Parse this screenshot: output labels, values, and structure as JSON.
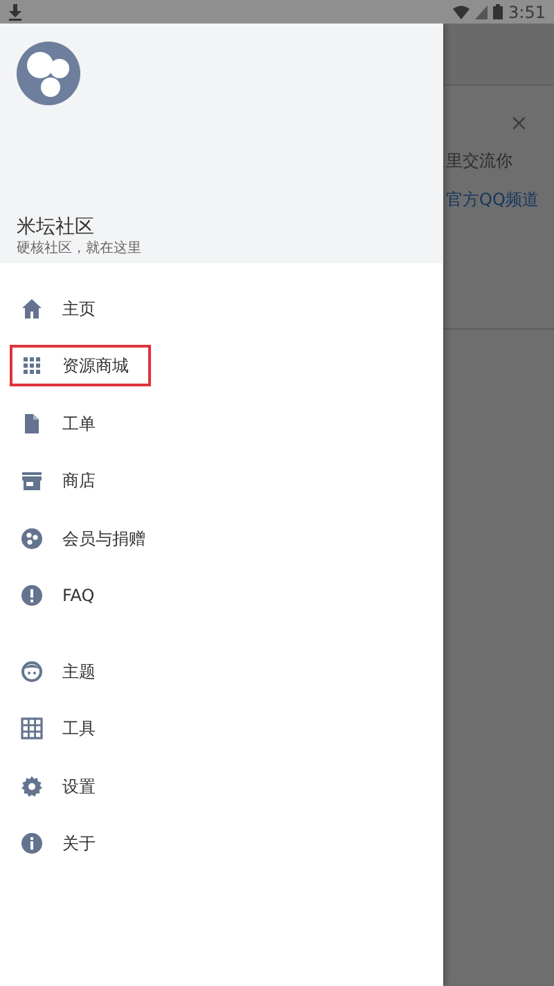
{
  "status_bar": {
    "time": "3:51"
  },
  "background": {
    "message": "里交流你",
    "link": "官方QQ频道",
    "close": "×"
  },
  "drawer": {
    "title": "米坛社区",
    "subtitle": "硬核社区，就在这里",
    "sections": [
      {
        "items": [
          {
            "label": "主页",
            "highlighted": false
          },
          {
            "label": "资源商城",
            "highlighted": true
          },
          {
            "label": "工单",
            "highlighted": false
          },
          {
            "label": "商店",
            "highlighted": false
          },
          {
            "label": "会员与捐赠",
            "highlighted": false
          },
          {
            "label": "FAQ",
            "highlighted": false
          }
        ]
      },
      {
        "items": [
          {
            "label": "主题",
            "highlighted": false
          },
          {
            "label": "工具",
            "highlighted": false
          },
          {
            "label": "设置",
            "highlighted": false
          },
          {
            "label": "关于",
            "highlighted": false
          }
        ]
      }
    ]
  }
}
